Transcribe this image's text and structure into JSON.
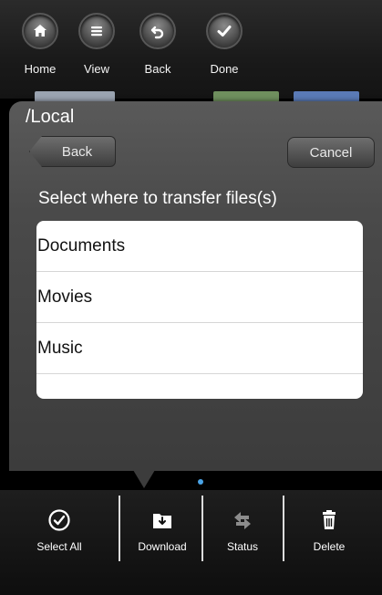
{
  "toolbar": {
    "home_label": "Home",
    "view_label": "View",
    "back_label": "Back",
    "done_label": "Done",
    "icons": [
      "home-icon",
      "list-icon",
      "undo-icon",
      "checkmark-icon"
    ]
  },
  "panel": {
    "path": "/Local",
    "back_label": "Back",
    "cancel_label": "Cancel",
    "prompt": "Select where to transfer files(s)",
    "folders": [
      "Documents",
      "Movies",
      "Music"
    ]
  },
  "bottom_bar": {
    "select_all_label": "Select All",
    "download_label": "Download",
    "status_label": "Status",
    "delete_label": "Delete",
    "icons": [
      "select-all-icon",
      "download-icon",
      "status-icon",
      "trash-icon"
    ]
  },
  "colors": {
    "page_indicator": "#4aa3e6",
    "panel_bg": "#4a4a4a",
    "list_bg": "#ffffff"
  }
}
